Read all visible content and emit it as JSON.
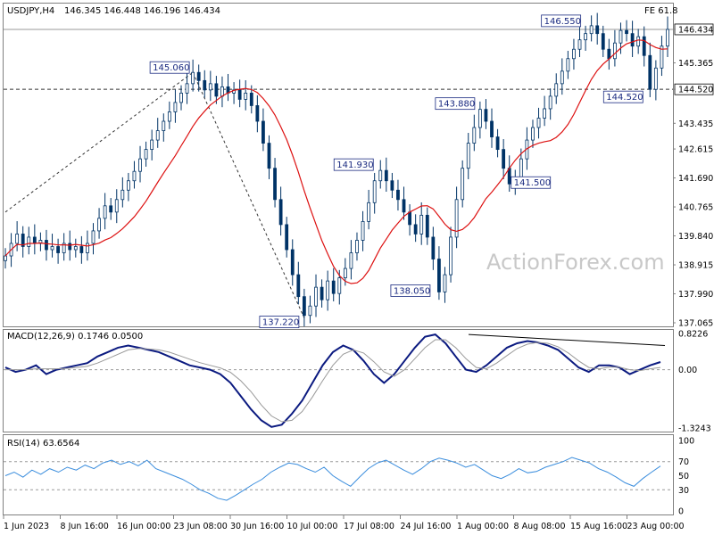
{
  "header": {
    "symbol": "USDJPY,H4",
    "ohlc": "146.345 146.448 146.196 146.434",
    "fib_label": "FE 61.8"
  },
  "watermark": "ActionForex.com",
  "chart_data": [
    {
      "type": "candlestick",
      "title": "USDJPY,H4 146.345 146.448 146.196 146.434",
      "ylim": [
        137.065,
        146.86
      ],
      "y_ticks": [
        "146.434",
        "145.365",
        "144.520",
        "143.435",
        "142.615",
        "141.690",
        "140.765",
        "139.840",
        "138.915",
        "137.990",
        "137.065"
      ],
      "last_price": 146.434,
      "series": [
        {
          "name": "price",
          "values": [
            139.2,
            139.6,
            139.9,
            139.5,
            139.8,
            139.6,
            139.7,
            139.4,
            139.5,
            139.3,
            139.6,
            139.4,
            139.5,
            139.3,
            139.6,
            140.0,
            140.4,
            140.8,
            140.6,
            141.0,
            141.3,
            141.6,
            141.9,
            142.3,
            142.6,
            142.9,
            143.2,
            143.5,
            143.8,
            144.1,
            144.4,
            144.7,
            145.06,
            144.8,
            144.5,
            144.7,
            144.3,
            144.6,
            144.4,
            144.5,
            144.2,
            144.4,
            144.0,
            143.5,
            142.8,
            142.0,
            141.0,
            140.2,
            139.4,
            138.6,
            137.9,
            137.3,
            137.6,
            138.2,
            137.8,
            138.4,
            138.0,
            138.5,
            138.8,
            139.3,
            139.7,
            140.3,
            140.9,
            141.6,
            141.93,
            141.6,
            141.3,
            141.0,
            140.6,
            140.2,
            139.9,
            140.5,
            139.8,
            139.1,
            138.05,
            138.6,
            139.8,
            141.0,
            142.0,
            142.8,
            143.3,
            143.88,
            143.5,
            143.0,
            142.6,
            142.0,
            141.5,
            141.7,
            142.3,
            142.9,
            143.3,
            143.6,
            143.9,
            144.3,
            144.7,
            145.1,
            145.5,
            145.8,
            146.1,
            146.3,
            146.55,
            146.3,
            145.8,
            145.5,
            146.0,
            146.4,
            146.3,
            145.9,
            146.2,
            145.6,
            144.52,
            145.2,
            145.9,
            146.434
          ]
        }
      ],
      "annotations": [
        "145.060",
        "146.550",
        "144.520",
        "143.880",
        "141.930",
        "141.500",
        "138.050",
        "137.220"
      ],
      "horizontal_levels": [
        146.434,
        144.52
      ],
      "x_tick_labels": [
        "1 Jun 2023",
        "8 Jun 16:00",
        "16 Jun 00:00",
        "23 Jun 08:00",
        "30 Jun 16:00",
        "10 Jul 00:00",
        "17 Jul 08:00",
        "24 Jul 16:00",
        "1 Aug 00:00",
        "8 Aug 08:00",
        "15 Aug 16:00",
        "23 Aug 00:00"
      ],
      "line_color": "#dd1111",
      "candle_color": "#003366"
    },
    {
      "type": "line",
      "title": "MACD(12,26,9) 0.1746 0.0500",
      "ylim": [
        -1.3243,
        0.8226
      ],
      "y_ticks": [
        "0.8226",
        "0.00",
        "-1.3243"
      ],
      "series": [
        {
          "name": "MACD",
          "values": [
            0.05,
            -0.05,
            0.0,
            0.1,
            -0.1,
            0.0,
            0.05,
            0.1,
            0.15,
            0.3,
            0.4,
            0.5,
            0.55,
            0.5,
            0.45,
            0.4,
            0.3,
            0.2,
            0.1,
            0.05,
            0.0,
            -0.1,
            -0.3,
            -0.6,
            -0.9,
            -1.15,
            -1.3,
            -1.25,
            -1.0,
            -0.7,
            -0.3,
            0.1,
            0.4,
            0.55,
            0.45,
            0.2,
            -0.1,
            -0.3,
            -0.1,
            0.2,
            0.5,
            0.75,
            0.8,
            0.6,
            0.3,
            0.0,
            -0.05,
            0.1,
            0.3,
            0.5,
            0.6,
            0.65,
            0.62,
            0.55,
            0.45,
            0.25,
            0.05,
            -0.05,
            0.1,
            0.1,
            0.05,
            -0.1,
            0.0,
            0.1,
            0.1746
          ]
        },
        {
          "name": "Signal",
          "values": [
            0.0,
            0.0,
            0.0,
            0.02,
            0.02,
            0.02,
            0.03,
            0.05,
            0.08,
            0.15,
            0.25,
            0.35,
            0.45,
            0.48,
            0.47,
            0.45,
            0.4,
            0.32,
            0.24,
            0.16,
            0.1,
            0.04,
            -0.06,
            -0.25,
            -0.5,
            -0.8,
            -1.05,
            -1.18,
            -1.15,
            -0.95,
            -0.62,
            -0.25,
            0.1,
            0.35,
            0.45,
            0.38,
            0.18,
            -0.05,
            -0.15,
            0.0,
            0.25,
            0.5,
            0.68,
            0.68,
            0.5,
            0.25,
            0.05,
            0.02,
            0.15,
            0.32,
            0.48,
            0.58,
            0.62,
            0.6,
            0.52,
            0.38,
            0.2,
            0.05,
            0.02,
            0.06,
            0.06,
            0.0,
            -0.02,
            0.02,
            0.05
          ]
        }
      ]
    },
    {
      "type": "line",
      "title": "RSI(14) 63.6564",
      "ylim": [
        0,
        100
      ],
      "y_ticks": [
        "100",
        "70",
        "50",
        "30",
        "0"
      ],
      "series": [
        {
          "name": "RSI",
          "values": [
            50,
            55,
            48,
            58,
            52,
            60,
            55,
            62,
            58,
            65,
            60,
            68,
            72,
            66,
            70,
            64,
            72,
            60,
            55,
            50,
            45,
            38,
            30,
            25,
            18,
            15,
            22,
            30,
            38,
            45,
            55,
            62,
            68,
            66,
            60,
            55,
            62,
            50,
            42,
            35,
            48,
            60,
            68,
            72,
            65,
            58,
            52,
            60,
            70,
            75,
            72,
            68,
            62,
            66,
            58,
            50,
            46,
            52,
            60,
            54,
            56,
            62,
            66,
            70,
            76,
            72,
            68,
            60,
            55,
            48,
            40,
            35,
            46,
            55,
            63.6564
          ]
        }
      ]
    }
  ]
}
